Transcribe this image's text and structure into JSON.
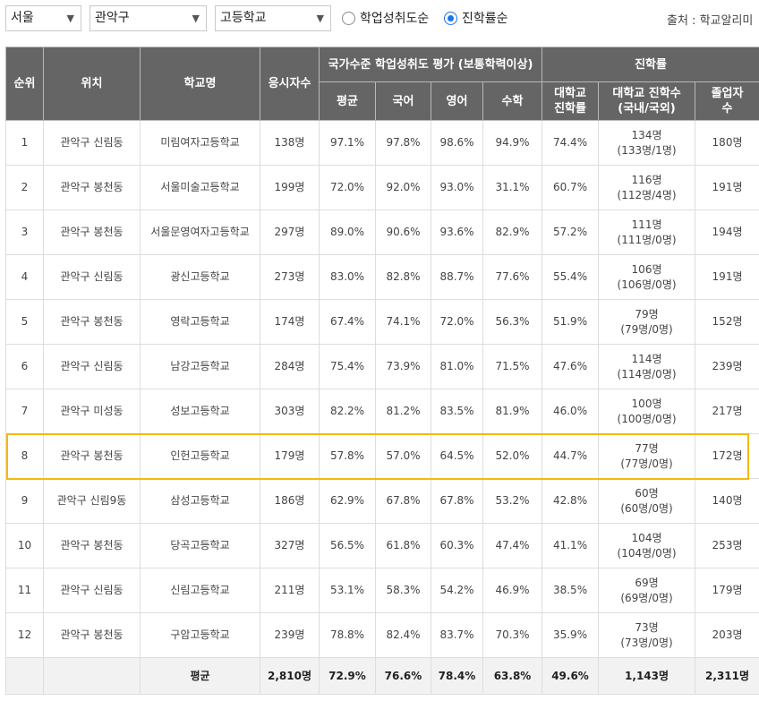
{
  "filters": {
    "region": "서울",
    "district": "관악구",
    "school_type": "고등학교",
    "sort_options": [
      {
        "label": "학업성취도순",
        "selected": false
      },
      {
        "label": "진학률순",
        "selected": true
      }
    ]
  },
  "source": "출처 : 학교알리미",
  "table": {
    "headers": {
      "rank": "순위",
      "location": "위치",
      "school": "학교명",
      "applicants": "응시자수",
      "achievement_group": "국가수준 학업성취도 평가 (보통학력이상)",
      "admission_group": "진학률",
      "avg": "평균",
      "korean": "국어",
      "english": "영어",
      "math": "수학",
      "univ_rate": "대학교\n진학률",
      "univ_count": "대학교 진학수\n(국내/국외)",
      "graduates": "졸업자\n수"
    },
    "rows": [
      {
        "rank": "1",
        "location": "관악구 신림동",
        "school": "미림여자고등학교",
        "applicants": "138명",
        "avg": "97.1%",
        "korean": "97.8%",
        "english": "98.6%",
        "math": "94.9%",
        "univ_rate": "74.4%",
        "univ_count": "134명\n(133명/1명)",
        "graduates": "180명"
      },
      {
        "rank": "2",
        "location": "관악구 봉천동",
        "school": "서울미술고등학교",
        "applicants": "199명",
        "avg": "72.0%",
        "korean": "92.0%",
        "english": "93.0%",
        "math": "31.1%",
        "univ_rate": "60.7%",
        "univ_count": "116명\n(112명/4명)",
        "graduates": "191명"
      },
      {
        "rank": "3",
        "location": "관악구 봉천동",
        "school": "서울문영여자고등학교",
        "applicants": "297명",
        "avg": "89.0%",
        "korean": "90.6%",
        "english": "93.6%",
        "math": "82.9%",
        "univ_rate": "57.2%",
        "univ_count": "111명\n(111명/0명)",
        "graduates": "194명"
      },
      {
        "rank": "4",
        "location": "관악구 신림동",
        "school": "광신고등학교",
        "applicants": "273명",
        "avg": "83.0%",
        "korean": "82.8%",
        "english": "88.7%",
        "math": "77.6%",
        "univ_rate": "55.4%",
        "univ_count": "106명\n(106명/0명)",
        "graduates": "191명"
      },
      {
        "rank": "5",
        "location": "관악구 봉천동",
        "school": "영락고등학교",
        "applicants": "174명",
        "avg": "67.4%",
        "korean": "74.1%",
        "english": "72.0%",
        "math": "56.3%",
        "univ_rate": "51.9%",
        "univ_count": "79명\n(79명/0명)",
        "graduates": "152명"
      },
      {
        "rank": "6",
        "location": "관악구 신림동",
        "school": "남강고등학교",
        "applicants": "284명",
        "avg": "75.4%",
        "korean": "73.9%",
        "english": "81.0%",
        "math": "71.5%",
        "univ_rate": "47.6%",
        "univ_count": "114명\n(114명/0명)",
        "graduates": "239명"
      },
      {
        "rank": "7",
        "location": "관악구 미성동",
        "school": "성보고등학교",
        "applicants": "303명",
        "avg": "82.2%",
        "korean": "81.2%",
        "english": "83.5%",
        "math": "81.9%",
        "univ_rate": "46.0%",
        "univ_count": "100명\n(100명/0명)",
        "graduates": "217명"
      },
      {
        "rank": "8",
        "location": "관악구 봉천동",
        "school": "인헌고등학교",
        "applicants": "179명",
        "avg": "57.8%",
        "korean": "57.0%",
        "english": "64.5%",
        "math": "52.0%",
        "univ_rate": "44.7%",
        "univ_count": "77명\n(77명/0명)",
        "graduates": "172명"
      },
      {
        "rank": "9",
        "location": "관악구 신림9동",
        "school": "삼성고등학교",
        "applicants": "186명",
        "avg": "62.9%",
        "korean": "67.8%",
        "english": "67.8%",
        "math": "53.2%",
        "univ_rate": "42.8%",
        "univ_count": "60명\n(60명/0명)",
        "graduates": "140명"
      },
      {
        "rank": "10",
        "location": "관악구 봉천동",
        "school": "당곡고등학교",
        "applicants": "327명",
        "avg": "56.5%",
        "korean": "61.8%",
        "english": "60.3%",
        "math": "47.4%",
        "univ_rate": "41.1%",
        "univ_count": "104명\n(104명/0명)",
        "graduates": "253명"
      },
      {
        "rank": "11",
        "location": "관악구 신림동",
        "school": "신림고등학교",
        "applicants": "211명",
        "avg": "53.1%",
        "korean": "58.3%",
        "english": "54.2%",
        "math": "46.9%",
        "univ_rate": "38.5%",
        "univ_count": "69명\n(69명/0명)",
        "graduates": "179명"
      },
      {
        "rank": "12",
        "location": "관악구 봉천동",
        "school": "구암고등학교",
        "applicants": "239명",
        "avg": "78.8%",
        "korean": "82.4%",
        "english": "83.7%",
        "math": "70.3%",
        "univ_rate": "35.9%",
        "univ_count": "73명\n(73명/0명)",
        "graduates": "203명"
      }
    ],
    "average_row": {
      "label": "평균",
      "applicants": "2,810명",
      "avg": "72.9%",
      "korean": "76.6%",
      "english": "78.4%",
      "math": "63.8%",
      "univ_rate": "49.6%",
      "univ_count": "1,143명",
      "graduates": "2,311명"
    },
    "highlighted_rank": "8",
    "highlight_color": "#f2b90f",
    "header_bg": "#656565"
  }
}
